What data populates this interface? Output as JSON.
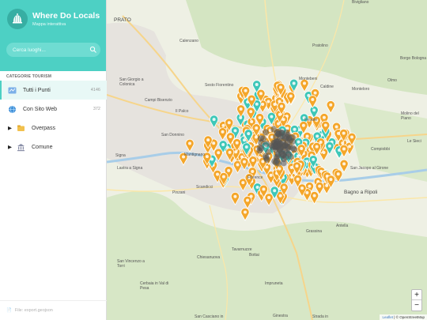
{
  "app": {
    "title": "Where Do Locals",
    "subtitle": "Mappa interattiva"
  },
  "search": {
    "placeholder": "Cerca luoghi..."
  },
  "categories": {
    "title": "CATEGORIE TOURISM",
    "items": [
      {
        "label": "Tutti i Punti",
        "count": "4146"
      },
      {
        "label": "Con Sito Web",
        "count": "372"
      },
      {
        "label": "Overpass",
        "count": ""
      },
      {
        "label": "Comune",
        "count": ""
      }
    ]
  },
  "footer": {
    "label": "File: export.geojson"
  },
  "map": {
    "labels": [
      "PRATO",
      "Calenzano",
      "Sesto Fiorentino",
      "Campi Bisenzio",
      "San Giorgio a Colonica",
      "Signa",
      "Lastra a Signa",
      "Scandicci",
      "Fiesole",
      "Montebeni",
      "Pratolino",
      "Bivigliano",
      "Borgo Bologna",
      "Olmo",
      "Monteloro",
      "Molino del Piano",
      "Le Sieci",
      "Compiobbi",
      "San Jacopo al Girone",
      "Bagno a Ripoli",
      "Antella",
      "Grassina",
      "Tavarnuzze",
      "Bottai",
      "Impruneta",
      "Chiesanuova",
      "San Vincenzo a Torri",
      "Cerbaia in Val di Pesa",
      "San Casciano in",
      "Strada in",
      "Ginestra",
      "Caldine",
      "San Donnino",
      "Mantignano",
      "Il Palco",
      "Pinzani",
      "Florence"
    ],
    "zoom_in": "+",
    "zoom_out": "−",
    "attribution_link": "Leaflet",
    "attribution_text": "| © OpenStreetMap",
    "marker_colors": {
      "orange": "#f4a62a",
      "teal": "#3ec7b8",
      "dense": "#555555"
    }
  }
}
